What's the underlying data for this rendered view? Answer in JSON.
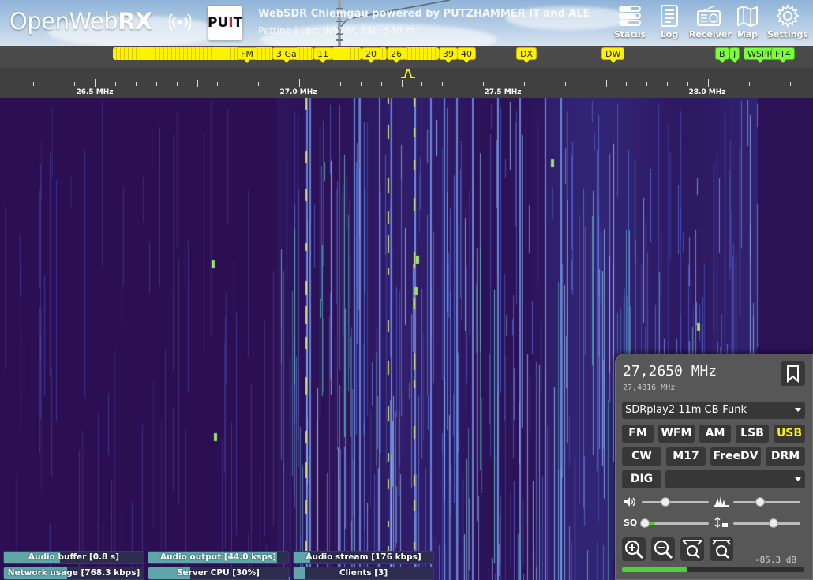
{
  "header": {
    "logo": "OpenWebRX",
    "sponsor_logo": {
      "text_black": "PU",
      "text_red": "I",
      "text_black2": "T"
    },
    "station_title": "WebSDR Chiemgau powered by PUTZHAMMER IT and ALE",
    "station_subtitle": "Petting | Loc: JN67IV, ASL: 540 m",
    "nav": [
      {
        "label": "Status",
        "icon": "status-icon"
      },
      {
        "label": "Log",
        "icon": "log-icon"
      },
      {
        "label": "Receiver",
        "icon": "receiver-icon"
      },
      {
        "label": "Map",
        "icon": "map-icon"
      },
      {
        "label": "Settings",
        "icon": "settings-icon"
      }
    ]
  },
  "bookmarks": {
    "channels": [
      "FM",
      "3 Ga",
      "11",
      "20",
      "26",
      "39",
      "40"
    ],
    "stations": [
      "DX",
      "DW"
    ],
    "digital": [
      "B",
      "J",
      "WSPR",
      "FT4"
    ]
  },
  "scale": {
    "labels": [
      "26.5 MHz",
      "27.0 MHz",
      "27.5 MHz",
      "28.0 MHz"
    ]
  },
  "receiver": {
    "frequency": "27,2650 MHz",
    "frequency_secondary": "27,4816 MHz",
    "profile": "SDRplay2 11m CB-Funk",
    "modes_row1": [
      "FM",
      "WFM",
      "AM",
      "LSB",
      "USB"
    ],
    "modes_row2": [
      "CW",
      "M17",
      "FreeDV",
      "DRM"
    ],
    "mode_dig": "DIG",
    "active_mode": "USB",
    "volume_level": 0.35,
    "squelch_level": 0.05,
    "nr_level": 0.4,
    "gain_level": 0.6,
    "signal_level_db": "-85.3 dB",
    "smeter_fraction": 0.36
  },
  "status_bars": [
    {
      "label": "Audio buffer [0.8 s]",
      "fill": 0.4
    },
    {
      "label": "Audio output [44.0 ksps]",
      "fill": 0.92
    },
    {
      "label": "Audio stream [176 kbps]",
      "fill": 0.12
    },
    {
      "label": "Network usage [768.3 kbps]",
      "fill": 0.45
    },
    {
      "label": "Server CPU [30%]",
      "fill": 0.3
    },
    {
      "label": "Clients [3]",
      "fill": 0.08
    }
  ],
  "colors": {
    "accent_mode": "#fff200",
    "meter": "#4cd137",
    "bookmark": "#fff200",
    "bookmark_digital": "#7cff3a"
  }
}
